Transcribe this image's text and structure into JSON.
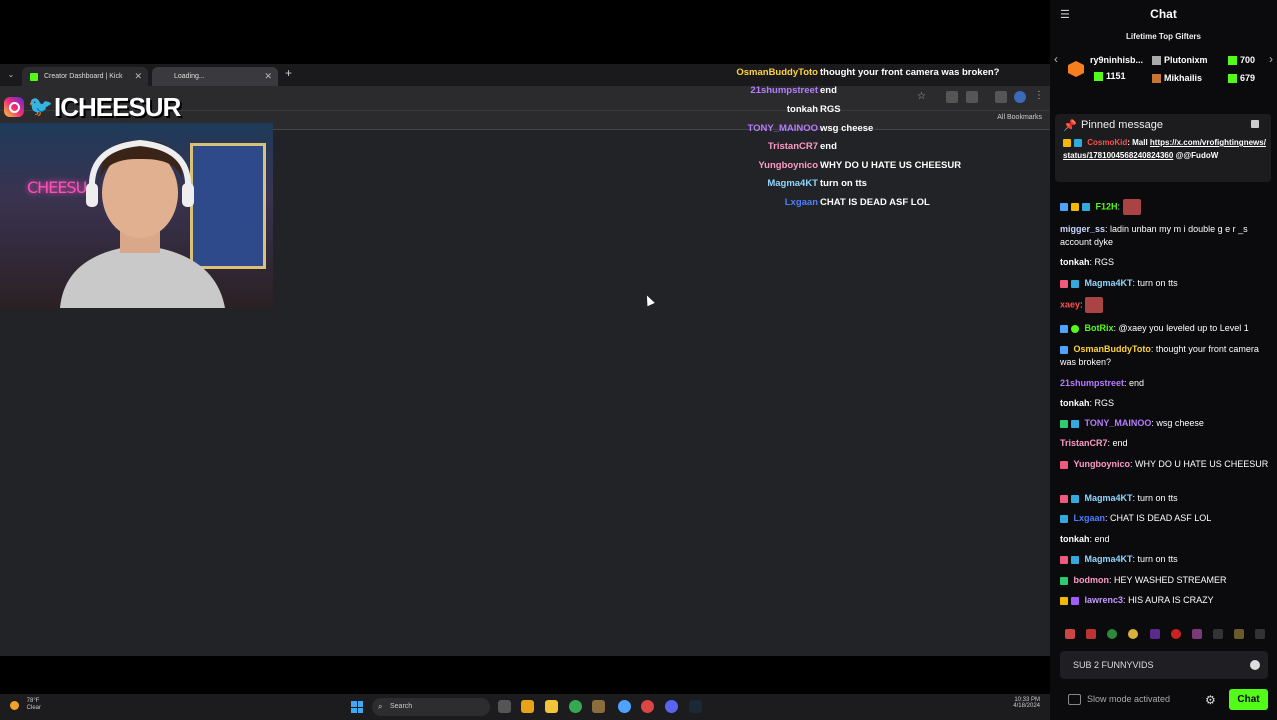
{
  "colors": {
    "kick_green": "#53fc18",
    "chat_bg": "#0b0b0d"
  },
  "browser": {
    "tabs": [
      {
        "label": "Creator Dashboard | Kick"
      },
      {
        "label": "Loading..."
      }
    ],
    "bookmarks_label": "All Bookmarks"
  },
  "overlay": {
    "streamer_name": "ICHEESUR",
    "neon_sign": "CHEESU",
    "chat": [
      {
        "name": "OsmanBuddyToto",
        "text": "thought your front camera was broken?",
        "color": "#ffd33d"
      },
      {
        "name": "21shumpstreet",
        "text": "end",
        "color": "#b57cff"
      },
      {
        "name": "tonkah",
        "text": "RGS",
        "color": "#ffffff"
      },
      {
        "name": "TONY_MAINOO",
        "text": "wsg cheese",
        "color": "#b57cff"
      },
      {
        "name": "TristanCR7",
        "text": "end",
        "color": "#ff9ac7"
      },
      {
        "name": "Yungboynico",
        "text": "WHY DO U HATE US CHEESUR",
        "color": "#ff9ac7"
      },
      {
        "name": "Magma4KT",
        "text": "turn on tts",
        "color": "#8fd6ff"
      },
      {
        "name": "Lxgaan",
        "text": "CHAT IS DEAD ASF LOL",
        "color": "#4f7dff"
      }
    ]
  },
  "taskbar": {
    "weather_temp": "78°F",
    "weather_desc": "Clear",
    "search_label": "Search",
    "time": "10:33 PM",
    "date": "4/18/2024"
  },
  "chat": {
    "title": "Chat",
    "gifters_title": "Lifetime Top Gifters",
    "gifters": [
      {
        "name": "ry9ninhisb...",
        "count": "1151"
      },
      {
        "name": "Plutonixm",
        "count": "700"
      },
      {
        "name": "Mikhailis",
        "count": "679"
      }
    ],
    "pinned": {
      "title": "Pinned message",
      "author": "CosmoKid",
      "prefix": "Mall",
      "link": "https://x.com/vrofightingnews/status/1781004568240824360",
      "suffix": "@@FudoW"
    },
    "messages": [
      {
        "name": "F12H",
        "text": "",
        "color": "#53fc18",
        "emote": true
      },
      {
        "name": "migger_ss",
        "text": "ladin unban my m i double g e r _s account dyke",
        "color": "#c8d6ff"
      },
      {
        "name": "tonkah",
        "text": "RGS",
        "color": "#ffffff"
      },
      {
        "name": "Magma4KT",
        "text": "turn on tts",
        "color": "#8fd6ff"
      },
      {
        "name": "xaey",
        "text": "",
        "color": "#ff4f4f",
        "emote": true
      },
      {
        "name": "BotRix",
        "text": "@xaey you leveled up to Level 1",
        "color": "#53fc18"
      },
      {
        "name": "OsmanBuddyToto",
        "text": "thought your front camera was broken?",
        "color": "#ffd33d"
      },
      {
        "name": "21shumpstreet",
        "text": "end",
        "color": "#b57cff"
      },
      {
        "name": "tonkah",
        "text": "RGS",
        "color": "#ffffff"
      },
      {
        "name": "TONY_MAINOO",
        "text": "wsg cheese",
        "color": "#b57cff"
      },
      {
        "name": "TristanCR7",
        "text": "end",
        "color": "#ff9ac7"
      },
      {
        "name": "Yungboynico",
        "text": "WHY DO U HATE US CHEESUR",
        "color": "#ff9ac7"
      },
      {
        "name": "Magma4KT",
        "text": "turn on tts",
        "color": "#8fd6ff"
      },
      {
        "name": "Lxgaan",
        "text": "CHAT IS DEAD ASF LOL",
        "color": "#4f7dff"
      },
      {
        "name": "tonkah",
        "text": "end",
        "color": "#ffffff"
      },
      {
        "name": "Magma4KT",
        "text": "turn on tts",
        "color": "#8fd6ff"
      },
      {
        "name": "bodmon",
        "text": "HEY WASHED STREAMER",
        "color": "#ff9ac7"
      },
      {
        "name": "lawrenc3",
        "text": "HIS AURA IS CRAZY",
        "color": "#c39bff"
      }
    ],
    "input_value": "SUB 2 FUNNYVIDS",
    "slow_mode": "Slow mode activated",
    "send_label": "Chat"
  }
}
